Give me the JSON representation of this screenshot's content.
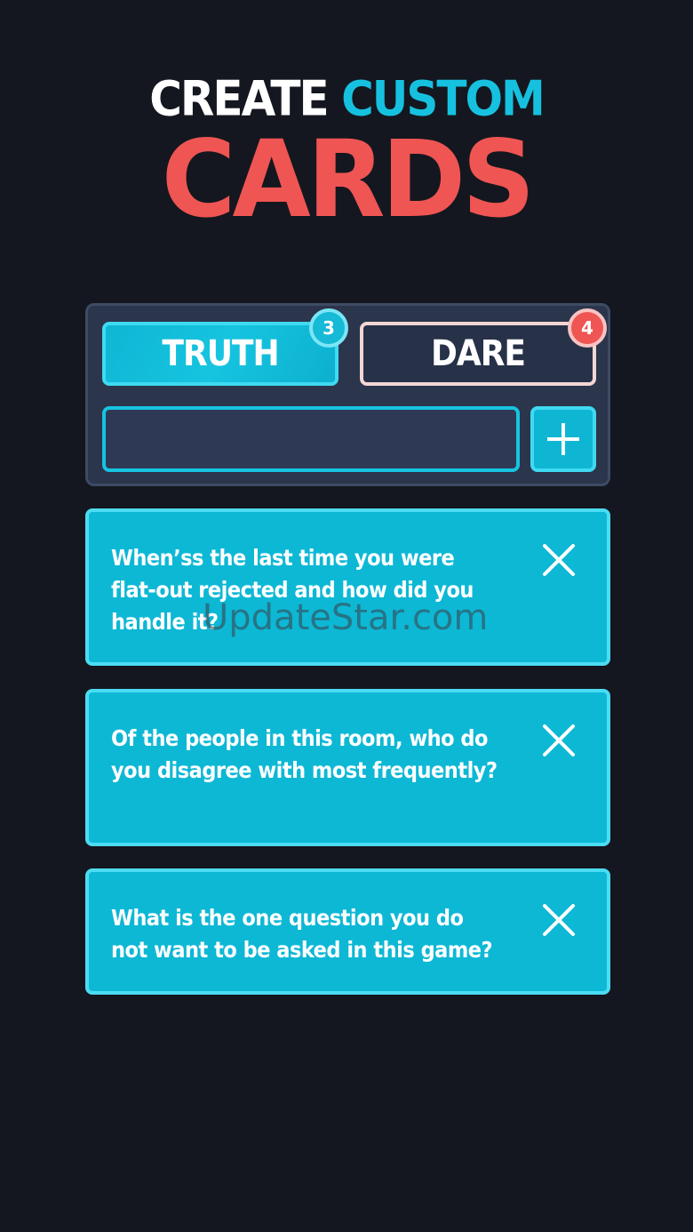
{
  "header": {
    "title_part1": "CREATE",
    "title_part2": "CUSTOM",
    "title_part3": "CARDS"
  },
  "tabs": [
    {
      "label": "TRUTH",
      "count": "3",
      "selected": true
    },
    {
      "label": "DARE",
      "count": "4",
      "selected": false
    }
  ],
  "input": {
    "value": "",
    "placeholder": ""
  },
  "add_button_icon": "plus-icon",
  "cards": [
    {
      "text": "When’ss the last time you were flat-out rejected and how did you handle it?",
      "close_icon": "close-icon"
    },
    {
      "text": "Of the people in this room, who do you disagree with most frequently?",
      "close_icon": "close-icon"
    },
    {
      "text": "What is the one question you do not want to be asked in this game?",
      "close_icon": "close-icon"
    }
  ],
  "watermark": "UpdateStar.com",
  "colors": {
    "background": "#14171f",
    "accent_cyan": "#16c1df",
    "accent_red": "#ef5553",
    "panel": "#2b354b"
  }
}
